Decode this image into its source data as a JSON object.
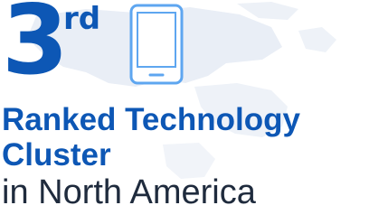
{
  "rank": {
    "number": "3",
    "suffix": "rd"
  },
  "icon": {
    "name": "smartphone-icon"
  },
  "headline": {
    "line1": "Ranked Technology",
    "line2": "Cluster"
  },
  "subline": "in North America",
  "colors": {
    "accent": "#0d57b5",
    "text_dark": "#1f2b3d",
    "map_tint": "#e9eef6",
    "background": "#ffffff"
  }
}
